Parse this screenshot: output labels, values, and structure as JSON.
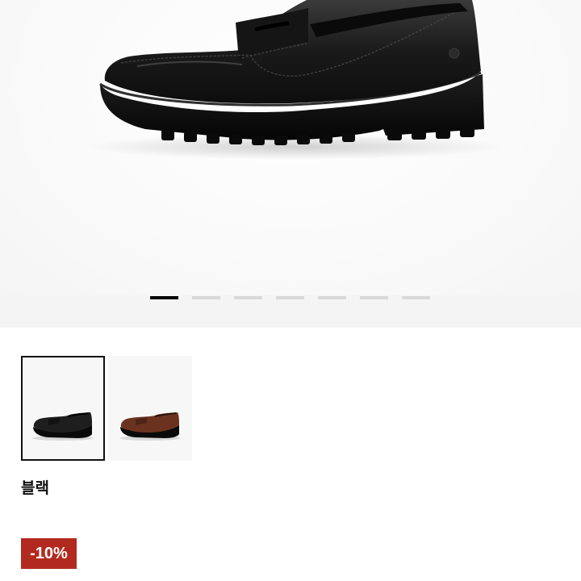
{
  "gallery": {
    "image_count": 7,
    "active_index": 0,
    "main_image": "black-penny-loafer-side-view"
  },
  "variants": {
    "items": [
      {
        "image": "black-loafer-thumbnail",
        "selected": true
      },
      {
        "image": "brown-loafer-thumbnail",
        "selected": false
      }
    ],
    "selected_color_label": "블랙"
  },
  "price": {
    "discount_badge": "-10%",
    "badge_color": "#b22a1f"
  }
}
